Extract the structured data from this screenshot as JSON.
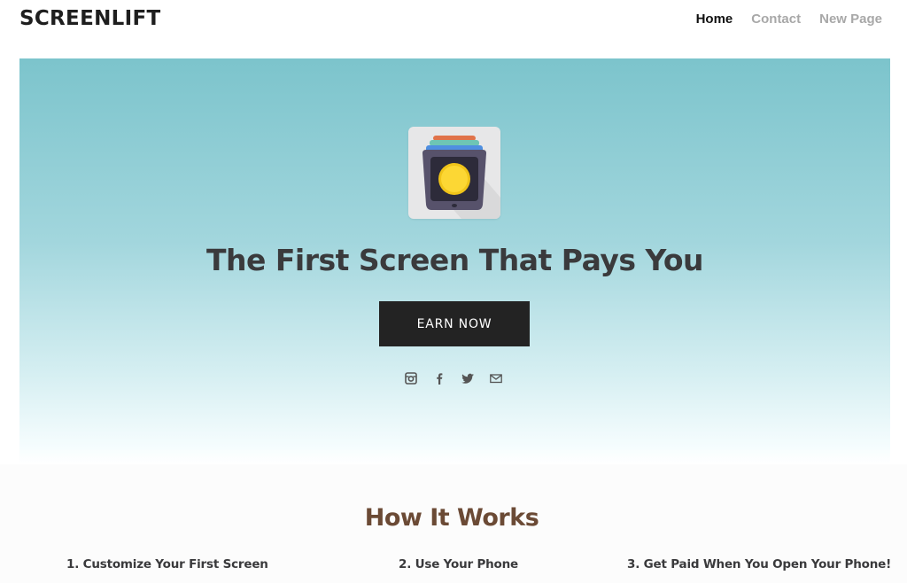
{
  "header": {
    "logo": "SCREENLIFT",
    "nav": [
      {
        "label": "Home",
        "active": true
      },
      {
        "label": "Contact",
        "active": false
      },
      {
        "label": "New Page",
        "active": false
      }
    ]
  },
  "hero": {
    "app_icon": "screenlift-app-icon",
    "headline": "The First Screen That Pays You",
    "cta_label": "EARN NOW",
    "socials": [
      {
        "icon": "instagram-icon"
      },
      {
        "icon": "facebook-icon"
      },
      {
        "icon": "twitter-icon"
      },
      {
        "icon": "email-icon"
      }
    ],
    "colors": {
      "gradient_top": "#7cc4cc",
      "gradient_bottom": "#ffffff",
      "button": "#232323"
    }
  },
  "how_it_works": {
    "title": "How It Works",
    "title_color": "#6b4a35",
    "steps": [
      "1. Customize Your First Screen",
      "2. Use Your Phone",
      "3. Get Paid When You Open Your Phone!"
    ]
  }
}
